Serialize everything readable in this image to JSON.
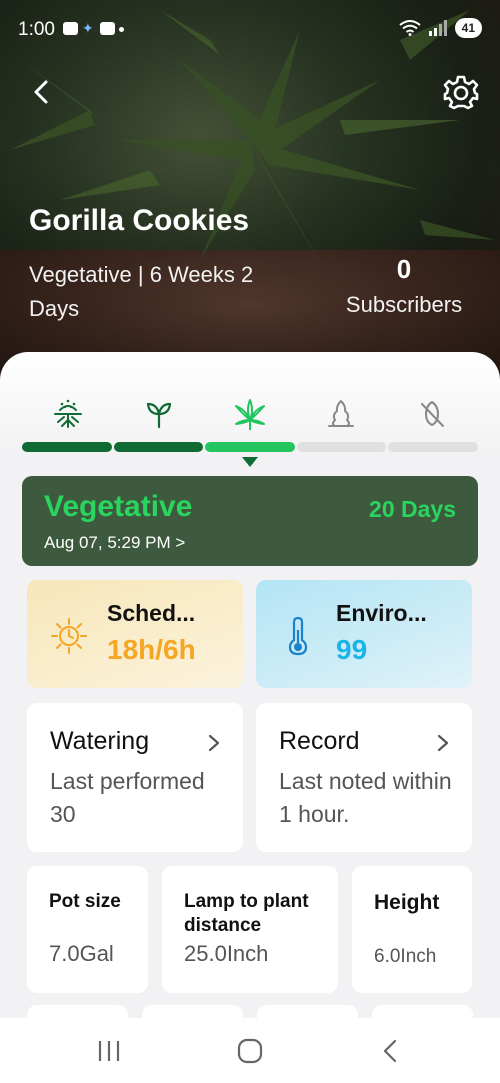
{
  "status": {
    "time": "1:00",
    "battery": "41"
  },
  "header": {
    "back_icon": "chevron-left-icon",
    "settings_icon": "gear-icon"
  },
  "plant": {
    "name": "Gorilla Cookies",
    "stage_line": "Vegetative | 6 Weeks 2 Days",
    "subscribers_count": "0",
    "subscribers_label": "Subscribers"
  },
  "stages": {
    "icons": [
      "germination-icon",
      "seedling-icon",
      "vegetative-leaf-icon",
      "flowering-icon",
      "harvest-icon"
    ],
    "progress_segments": [
      "done",
      "done",
      "current",
      "todo",
      "todo"
    ]
  },
  "current_stage": {
    "title": "Vegetative",
    "days": "20 Days",
    "date": "Aug 07, 5:29 PM >"
  },
  "schedule": {
    "title": "Sched...",
    "value": "18h/6h",
    "icon": "sun-icon",
    "color": "#f6a623"
  },
  "environment": {
    "title": "Enviro...",
    "value": "99",
    "icon": "thermometer-icon",
    "color": "#1ab4e8"
  },
  "watering": {
    "title": "Watering",
    "subtitle": "Last performed 30"
  },
  "record": {
    "title": "Record",
    "subtitle": "Last noted within 1 hour."
  },
  "metrics": {
    "pot": {
      "label": "Pot size",
      "value": "7.0Gal"
    },
    "lamp": {
      "label": "Lamp to plant distance",
      "value": "25.0Inch"
    },
    "height": {
      "label": "Height",
      "value": "6.0Inch"
    }
  },
  "colors": {
    "accent_green": "#29d55d",
    "stage_card_bg": "#3d5a3f",
    "progress_done": "#0f6b33"
  }
}
